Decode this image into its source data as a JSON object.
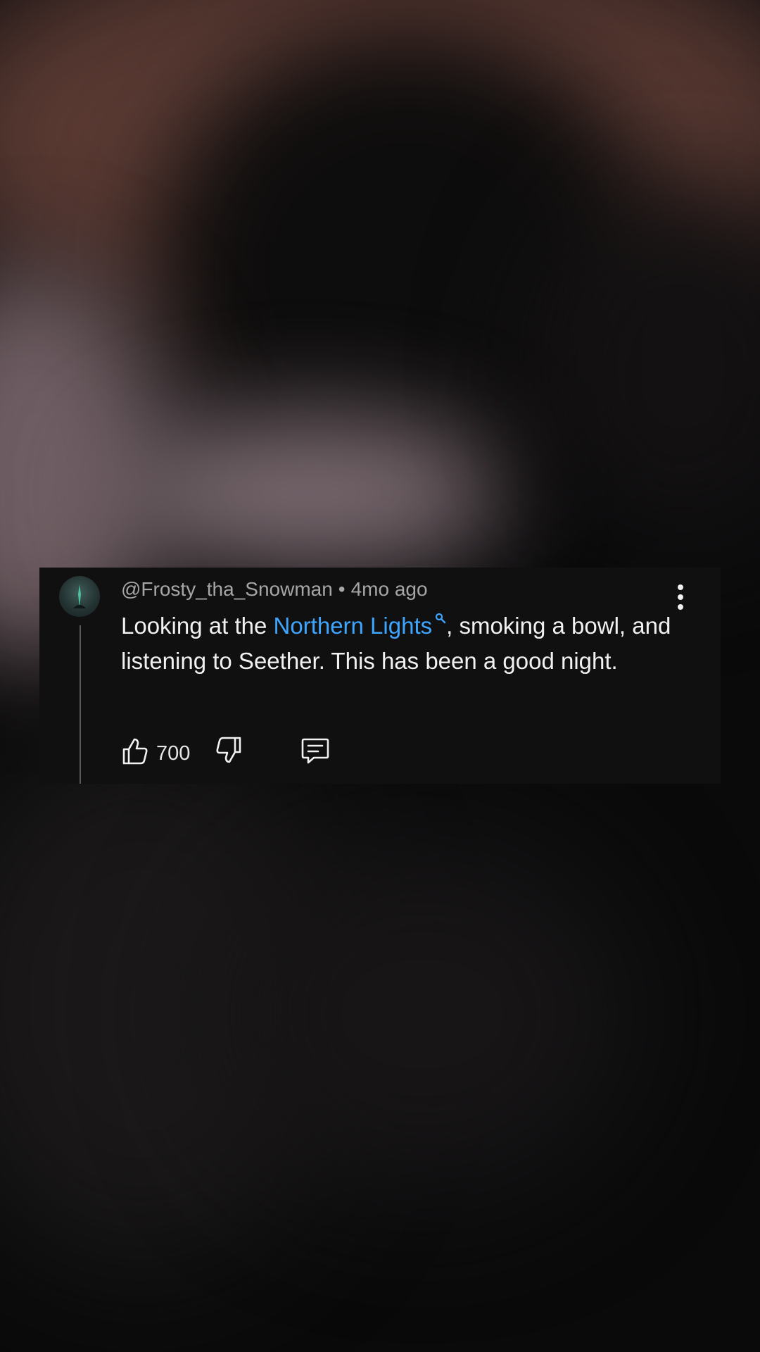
{
  "comment": {
    "author": "@Frosty_tha_Snowman",
    "separator": "•",
    "timestamp": "4mo ago",
    "text_before_link": "Looking at the ",
    "link_text": "Northern Lights",
    "text_after_link": ", smoking a bowl, and listening to Seether. This has been a good night.",
    "like_count": "700"
  },
  "icons": {
    "avatar": "avatar",
    "more": "more-vert-icon",
    "link_search": "search-icon",
    "like": "thumb-up-icon",
    "dislike": "thumb-down-icon",
    "reply": "comment-reply-icon"
  },
  "colors": {
    "card_background": "#101011",
    "link": "#3ea6ff",
    "meta_text": "#a6a6a6",
    "body_text": "#f1f1f1"
  }
}
